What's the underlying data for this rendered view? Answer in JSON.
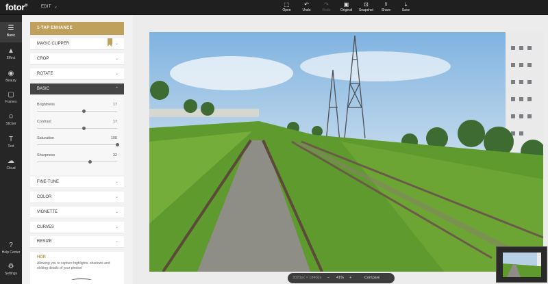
{
  "app": {
    "logo": "fotor",
    "logo_mark": "®",
    "edit_menu": "EDIT"
  },
  "toolbar": [
    {
      "label": "Open",
      "icon": "open-icon",
      "enabled": true
    },
    {
      "label": "Undo",
      "icon": "undo-icon",
      "enabled": true
    },
    {
      "label": "Redo",
      "icon": "redo-icon",
      "enabled": false
    },
    {
      "label": "Original",
      "icon": "original-icon",
      "enabled": true
    },
    {
      "label": "Snapshot",
      "icon": "snapshot-icon",
      "enabled": true
    },
    {
      "label": "Share",
      "icon": "share-icon",
      "enabled": true
    },
    {
      "label": "Save",
      "icon": "save-icon",
      "enabled": true
    }
  ],
  "rail": [
    {
      "label": "Basic",
      "icon": "sliders-icon",
      "active": true
    },
    {
      "label": "Effect",
      "icon": "effect-icon"
    },
    {
      "label": "Beauty",
      "icon": "beauty-icon"
    },
    {
      "label": "Frames",
      "icon": "frames-icon"
    },
    {
      "label": "Sticker",
      "icon": "sticker-icon"
    },
    {
      "label": "Text",
      "icon": "text-icon"
    },
    {
      "label": "Cloud",
      "icon": "cloud-icon"
    },
    {
      "label": "Help Center",
      "icon": "help-icon"
    },
    {
      "label": "Settings",
      "icon": "settings-icon"
    }
  ],
  "panel": {
    "enhance_label": "1-TAP ENHANCE",
    "sections_top": [
      "MAGIC CLIPPER",
      "CROP",
      "ROTATE",
      "BASIC"
    ],
    "sliders": [
      {
        "label": "Brightness",
        "value": "17",
        "fraction": 0.58
      },
      {
        "label": "Contrast",
        "value": "17",
        "fraction": 0.58
      },
      {
        "label": "Saturation",
        "value": "100",
        "fraction": 1.0
      },
      {
        "label": "Sharpness",
        "value": "32",
        "fraction": 0.66
      }
    ],
    "sections_bottom": [
      "FINE-TUNE",
      "COLOR",
      "VIGNETTE",
      "CURVES",
      "RESIZE"
    ],
    "hdr": {
      "title": "HDR",
      "description": "Allowing you to capture highlights, shadows and striking details of your photos!"
    }
  },
  "bottom_bar": {
    "dimensions": "3020px × 1840px",
    "zoom_minus": "−",
    "zoom": "41%",
    "zoom_plus": "+",
    "compare": "Compare"
  },
  "colors": {
    "accent": "#bfa15b",
    "dark_bar": "#1f1f1f",
    "rail": "#262626"
  }
}
